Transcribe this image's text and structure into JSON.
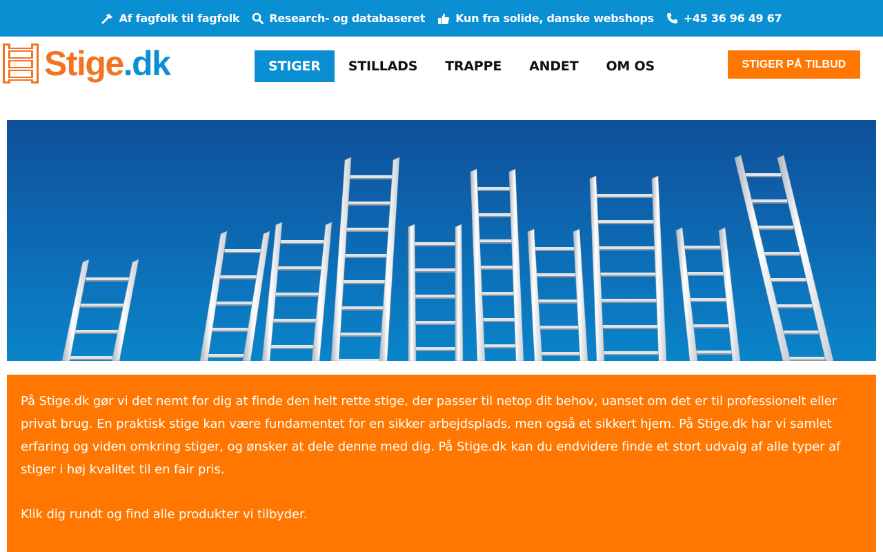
{
  "topbar": {
    "items": [
      {
        "icon": "hammer-icon",
        "label": "Af fagfolk til fagfolk"
      },
      {
        "icon": "search-icon",
        "label": "Research- og databaseret"
      },
      {
        "icon": "thumbs-up-icon",
        "label": "Kun fra solide, danske webshops"
      },
      {
        "icon": "phone-icon",
        "label": "+45 36 96 49 67"
      }
    ]
  },
  "header": {
    "logo": {
      "name": "Stige",
      "tld": ".dk"
    },
    "nav": [
      {
        "label": "STIGER",
        "active": true
      },
      {
        "label": "STILLADS",
        "active": false
      },
      {
        "label": "TRAPPE",
        "active": false
      },
      {
        "label": "ANDET",
        "active": false
      },
      {
        "label": "OM OS",
        "active": false
      }
    ],
    "cta_label": "STIGER PÅ TILBUD"
  },
  "hero": {
    "icon": "ladders-image"
  },
  "intro": {
    "paragraph1": "På Stige.dk gør vi det nemt for dig at finde den helt rette stige, der passer til netop dit behov, uanset om det er til professionelt eller privat brug. En praktisk stige kan være fundamentet for en sikker arbejdsplads, men også et sikkert hjem. På Stige.dk har vi samlet erfaring og viden omkring stiger, og ønsker at dele denne med dig. På Stige.dk kan du endvidere finde et stort udvalg af alle typer af stiger i høj kvalitet til en fair pris.",
    "paragraph2": "Klik dig rundt og find alle produkter vi tilbyder."
  },
  "colors": {
    "brand_blue": "#0b8fd3",
    "brand_orange": "#ff7700",
    "logo_orange": "#f37321"
  }
}
